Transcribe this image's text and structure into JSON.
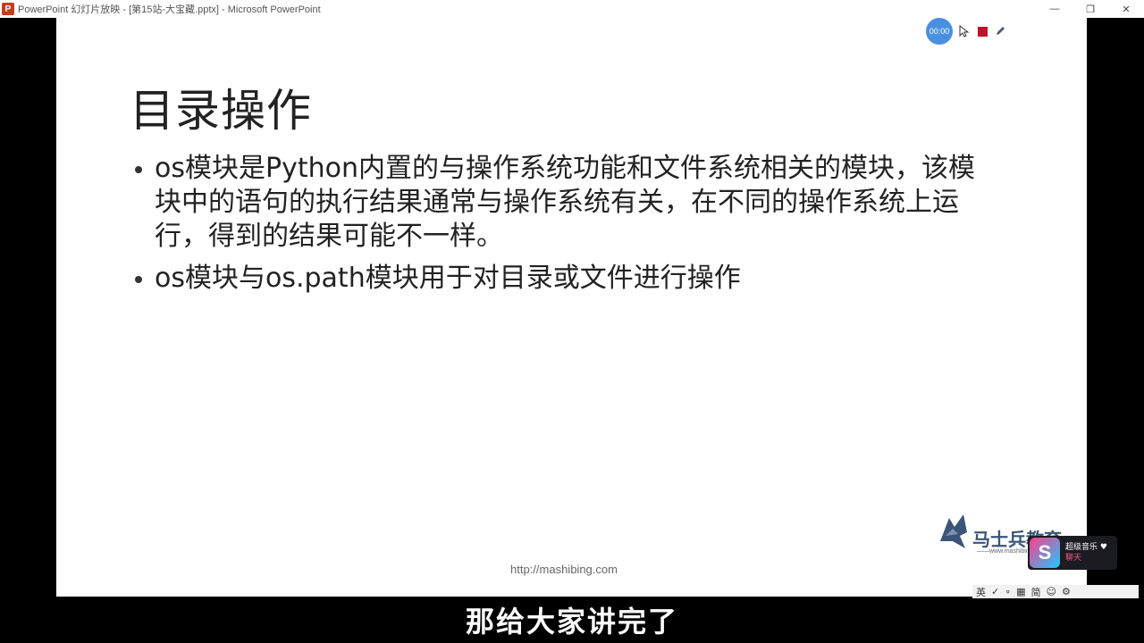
{
  "window": {
    "title": "PowerPoint 幻灯片放映 - [第15站-大宝藏.pptx] - Microsoft PowerPoint",
    "app_icon": "P",
    "controls": {
      "minimize": "—",
      "restore": "❐",
      "close": "✕"
    }
  },
  "presenter_toolbar": {
    "timer": "00:00",
    "icons": [
      "cursor-icon",
      "stop-icon",
      "pen-icon"
    ],
    "stop_color": "#c0102a"
  },
  "slide": {
    "title": "目录操作",
    "bullets": [
      "os模块是Python内置的与操作系统功能和文件系统相关的模块，该模块中的语句的执行结果通常与操作系统有关，在不同的操作系统上运行，得到的结果可能不一样。",
      "os模块与os.path模块用于对目录或文件进行操作"
    ],
    "footer_url": "http://mashibing.com"
  },
  "logo": {
    "text": "马士兵教育",
    "subtext": "——www.mashibing.com"
  },
  "widget": {
    "badge": "S",
    "title": "超级音乐 ♥",
    "subtitle": "聊天"
  },
  "ime_bar": {
    "items": [
      "英",
      "✓",
      "∘",
      "▦",
      "简",
      "☺",
      "⚙"
    ]
  },
  "subtitle": "那给大家讲完了",
  "colors": {
    "timer_bg": "#4a90e2",
    "text": "#222222",
    "background": "#000000"
  }
}
